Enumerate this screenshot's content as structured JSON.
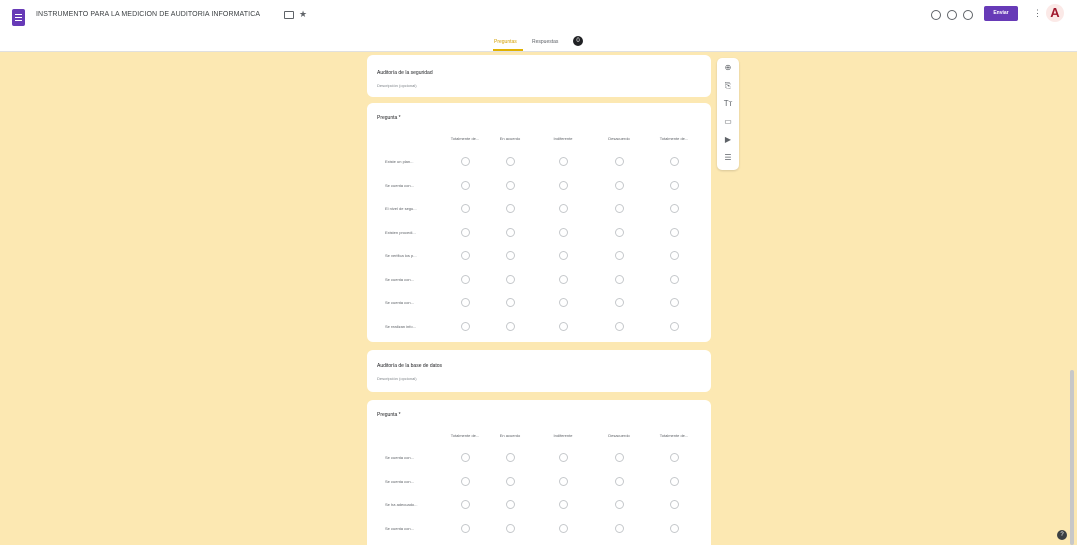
{
  "app": {
    "title": "INSTRUMENTO PARA LA MEDICION DE AUDITORIA INFORMATICA",
    "icon": "google-forms-icon",
    "accent": "#673ab7",
    "theme_color": "#fce8b2"
  },
  "header": {
    "send_label": "Enviar",
    "avatar_letter": "A",
    "tabs": [
      {
        "label": "Preguntas",
        "active": true
      },
      {
        "label": "Respuestas",
        "active": false
      }
    ],
    "responses_badge": "0"
  },
  "sections": [
    {
      "title": "Auditoría de la seguridad",
      "description": "Descripción (opcional)"
    },
    {
      "title": "Auditoría de la base de datos",
      "description": "Descripción (opcional)"
    }
  ],
  "grid_questions": [
    {
      "title": "Pregunta *",
      "columns": [
        "Totalmente de...",
        "En acuerdo",
        "Indiferente",
        "Desacuerdo",
        "Totalmente de..."
      ],
      "rows": [
        "Existe un plan...",
        "Se cuenta con...",
        "El nivel de segu...",
        "Existen procedi...",
        "Se verifica los p...",
        "Se cuenta con...",
        "Se cuenta con...",
        "Se realizan info..."
      ]
    },
    {
      "title": "Pregunta *",
      "columns": [
        "Totalmente de...",
        "En acuerdo",
        "Indiferente",
        "Desacuerdo",
        "Totalmente de..."
      ],
      "rows": [
        "Se cuenta con...",
        "Se cuenta con...",
        "Se ha adecuado...",
        "Se cuenta con..."
      ]
    }
  ],
  "toolbar": [
    "add-question-icon",
    "import-questions-icon",
    "add-title-icon",
    "add-image-icon",
    "add-video-icon",
    "add-section-icon"
  ],
  "help_label": "?"
}
